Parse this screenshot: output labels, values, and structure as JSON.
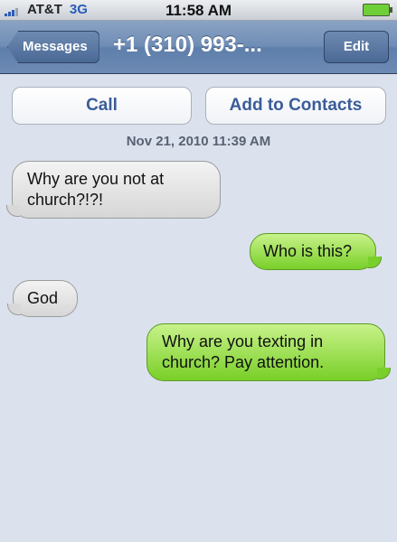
{
  "status_bar": {
    "carrier": "AT&T",
    "network": "3G",
    "time": "11:58 AM"
  },
  "nav": {
    "back_label": "Messages",
    "title": "+1 (310) 993-...",
    "edit_label": "Edit"
  },
  "actions": {
    "call_label": "Call",
    "add_contact_label": "Add to Contacts"
  },
  "thread": {
    "timestamp": "Nov 21, 2010 11:39 AM",
    "messages": [
      {
        "direction": "incoming",
        "text": "Why are you not at church?!?!"
      },
      {
        "direction": "outgoing",
        "text": "Who is this?"
      },
      {
        "direction": "incoming",
        "text": "God"
      },
      {
        "direction": "outgoing",
        "text": "Why are you texting in church? Pay attention."
      }
    ]
  },
  "colors": {
    "incoming_bubble": "#d6d6d6",
    "outgoing_bubble": "#79cf28",
    "background": "#dbe2ed",
    "nav_bar": "#6f8db5",
    "button_text": "#3b5c99"
  }
}
